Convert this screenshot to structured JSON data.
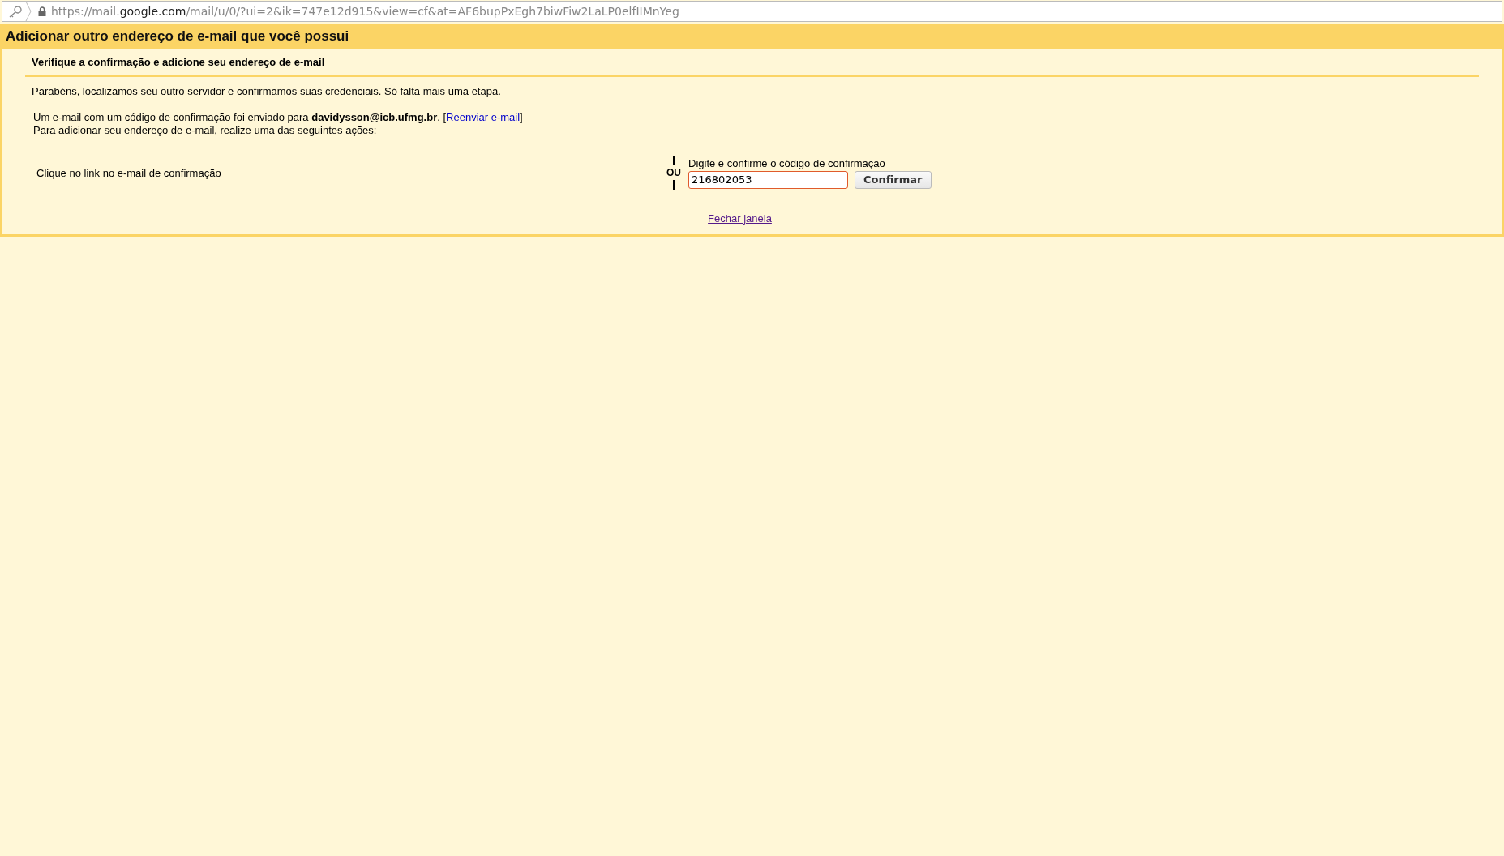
{
  "address_bar": {
    "url_start": "https://mail.",
    "url_domain": "google.com",
    "url_rest": "/mail/u/0/?ui=2&ik=747e12d915&view=cf&at=AF6bupPxEgh7biwFiw2LaLP0elfIIMnYeg"
  },
  "dialog": {
    "title": "Adicionar outro endereço de e-mail que você possui",
    "subtitle": "Verifique a confirmação e adicione seu endereço de e-mail",
    "intro": "Parabéns, localizamos seu outro servidor e confirmamos suas credenciais. Só falta mais uma etapa.",
    "sent_text": "Um e-mail com um código de confirmação foi enviado para **davidysson@icb.ufmg.br**. [",
    "resend_link": "Reenviar e-mail",
    "sent_close": "]",
    "instruction": "Para adicionar seu endereço de e-mail, realize uma das seguintes ações:",
    "option_link": "Clique no link no e-mail de confirmação",
    "separator": "OU",
    "code_label": "Digite e confirme o código de confirmação",
    "code_value": "216802053",
    "confirm_button": "Confirmar",
    "close_link": "Fechar janela"
  }
}
